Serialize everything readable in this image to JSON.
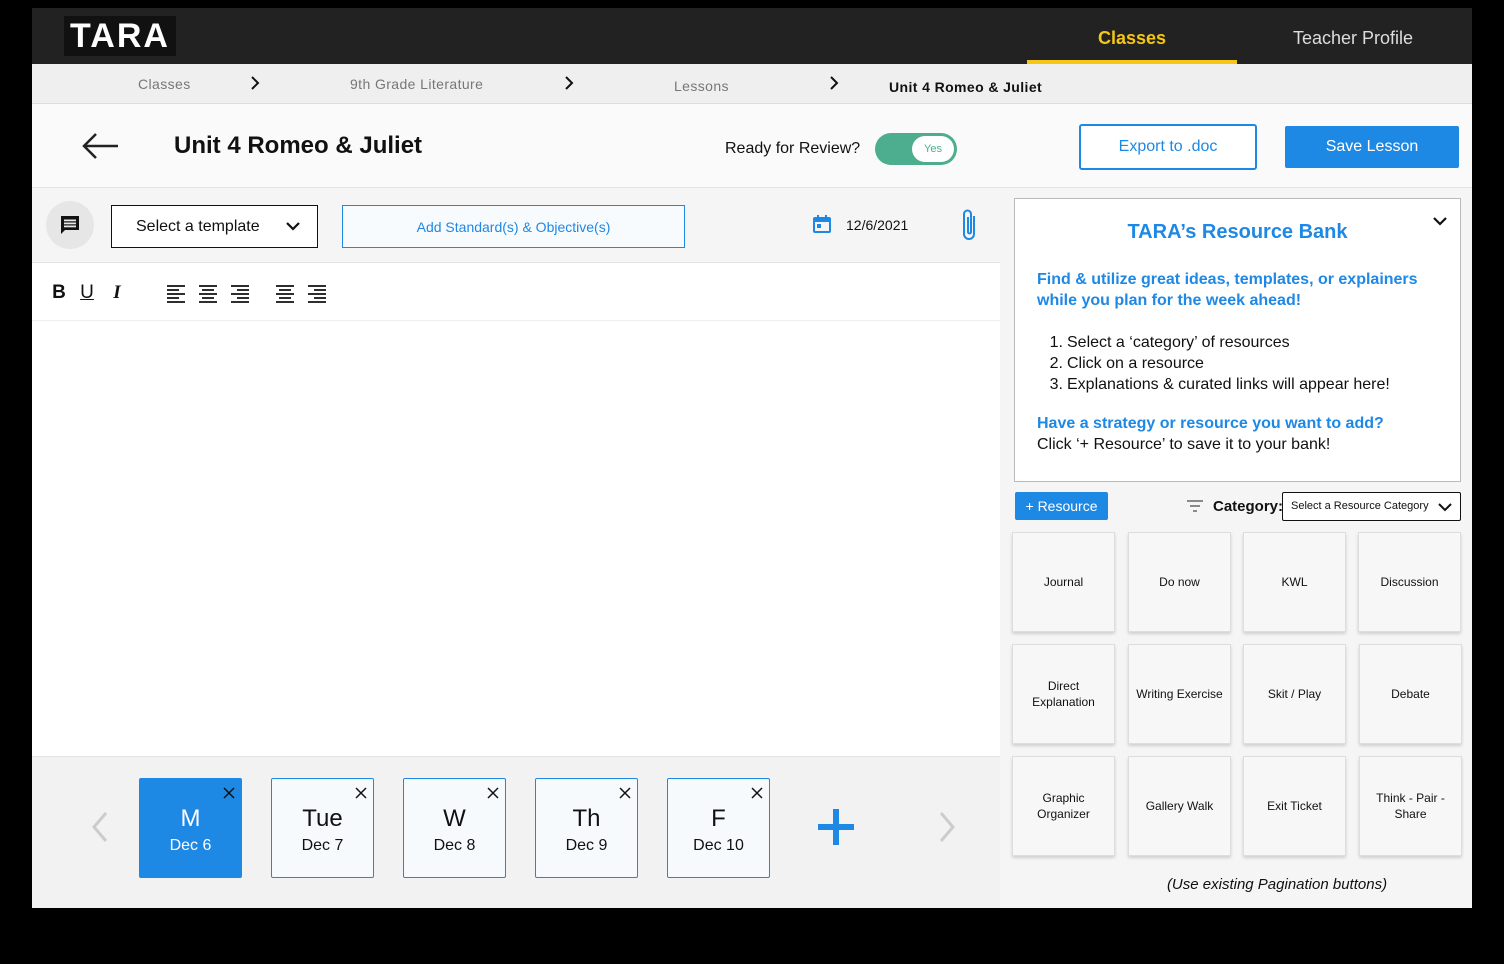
{
  "app": {
    "logo": "TARA",
    "nav": {
      "classes": "Classes",
      "teacher_profile": "Teacher Profile"
    },
    "accent_color": "#1e88e5",
    "nav_highlight_color": "#f5c518",
    "toggle_color": "#4dae8f"
  },
  "breadcrumb": [
    "Classes",
    "9th Grade Literature",
    "Lessons",
    "Unit 4 Romeo & Juliet"
  ],
  "header": {
    "title": "Unit 4 Romeo & Juliet",
    "review_label": "Ready for Review?",
    "review_toggle": "Yes",
    "export_label": "Export to .doc",
    "save_label": "Save Lesson"
  },
  "editor": {
    "template_select": "Select a template",
    "standards_button": "Add Standard(s) & Objective(s)",
    "date": "12/6/2021",
    "format_tools": [
      "bold-icon",
      "underline-icon",
      "italic-icon",
      "align-left-icon",
      "align-center-icon",
      "align-right-icon",
      "justify-center-icon",
      "justify-right-icon"
    ]
  },
  "days": [
    {
      "abbr": "M",
      "date": "Dec 6",
      "active": true
    },
    {
      "abbr": "Tue",
      "date": "Dec 7",
      "active": false
    },
    {
      "abbr": "W",
      "date": "Dec 8",
      "active": false
    },
    {
      "abbr": "Th",
      "date": "Dec 9",
      "active": false
    },
    {
      "abbr": "F",
      "date": "Dec 10",
      "active": false
    }
  ],
  "resource_bank": {
    "title": "TARA’s Resource Bank",
    "intro": "Find & utilize great ideas, templates, or explainers while you plan for the week ahead!",
    "steps": [
      "Select a ‘category’ of resources",
      "Click on a resource",
      "Explanations & curated links will appear here!"
    ],
    "question": "Have a strategy or resource you want to add?",
    "click_note": "Click ‘+ Resource’ to save it to your bank!",
    "add_button": "+ Resource",
    "category_label": "Category:",
    "category_select": "Select a Resource Category",
    "tiles": [
      "Journal",
      "Do now",
      "KWL",
      "Discussion",
      "Direct Explanation",
      "Writing Exercise",
      "Skit / Play",
      "Debate",
      "Graphic Organizer",
      "Gallery Walk",
      "Exit Ticket",
      "Think - Pair - Share"
    ],
    "pagination_note": "(Use existing Pagination buttons)"
  }
}
